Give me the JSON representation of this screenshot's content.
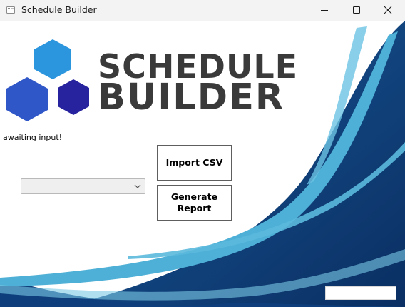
{
  "window": {
    "title": "Schedule Builder",
    "controls": {
      "minimize": "minimize-icon",
      "maximize": "maximize-icon",
      "close": "close-icon"
    }
  },
  "logo": {
    "line1": "SCHEDULE",
    "line2": "BUILDER",
    "hex_colors": [
      "#2b96de",
      "#2f57c8",
      "#27239e"
    ],
    "text_color": "#3a3a3a"
  },
  "status": {
    "text": "awaiting input!"
  },
  "combo": {
    "value": "",
    "arrow_icon": "chevron-down-icon"
  },
  "buttons": {
    "import_label": "Import CSV",
    "report_label": "Generate Report"
  },
  "colors": {
    "swoosh_dark": "#0d3d78",
    "swoosh_light": "#4eb0d6",
    "swoosh_mid": "#1f6aa6"
  }
}
